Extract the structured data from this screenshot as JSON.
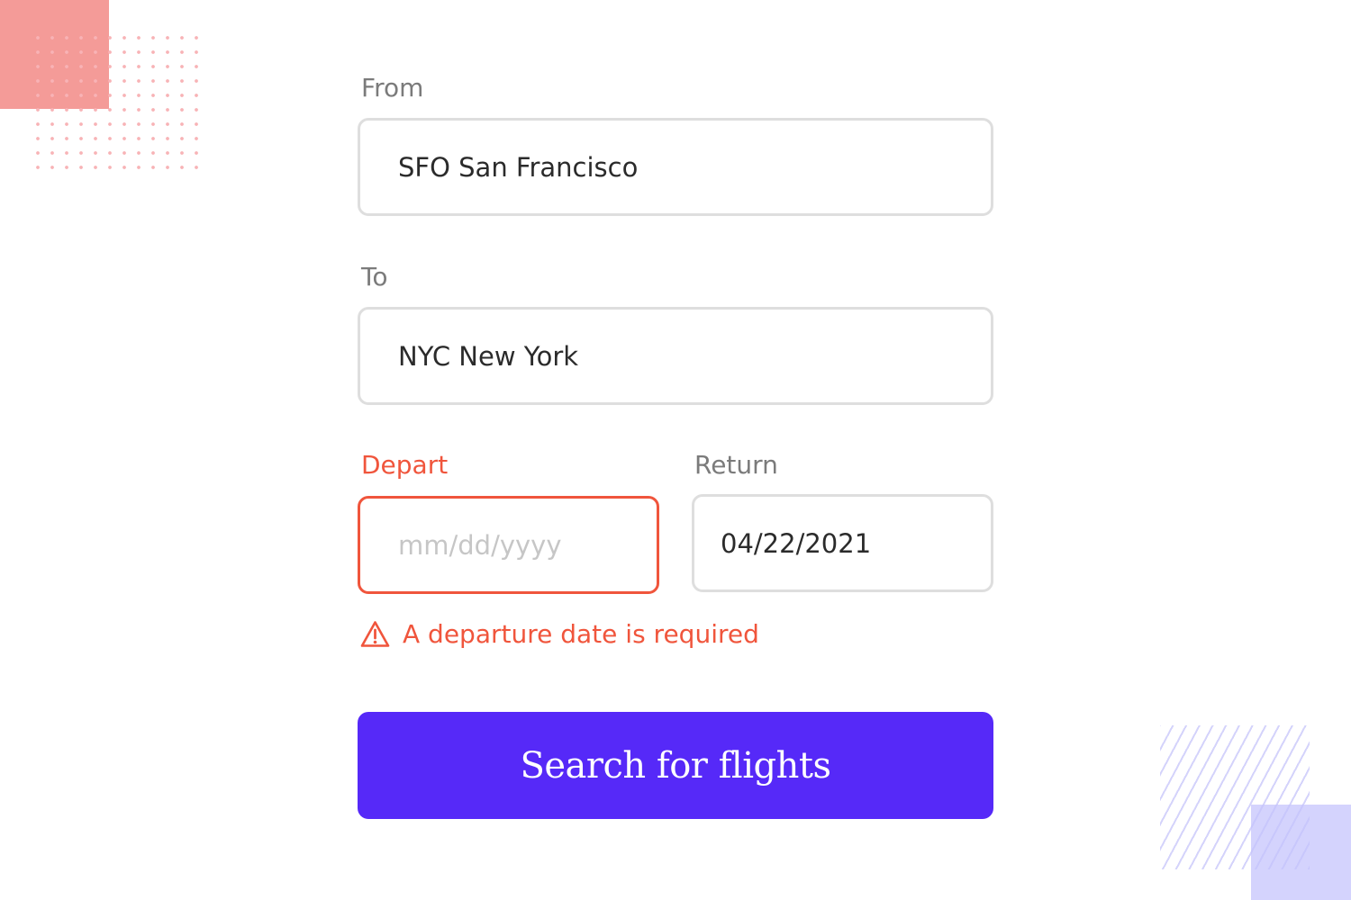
{
  "form": {
    "from": {
      "label": "From",
      "value": "SFO San Francisco"
    },
    "to": {
      "label": "To",
      "value": "NYC New York"
    },
    "depart": {
      "label": "Depart",
      "value": "",
      "placeholder": "mm/dd/yyyy"
    },
    "return": {
      "label": "Return",
      "value": "04/22/2021"
    },
    "error_message": "A departure date is required",
    "submit_label": "Search for flights"
  },
  "icons": {
    "error": "warning-triangle-icon"
  },
  "colors": {
    "accent": "#5629f8",
    "error": "#f0553c",
    "border": "#dedede",
    "label": "#7b7b7b"
  }
}
